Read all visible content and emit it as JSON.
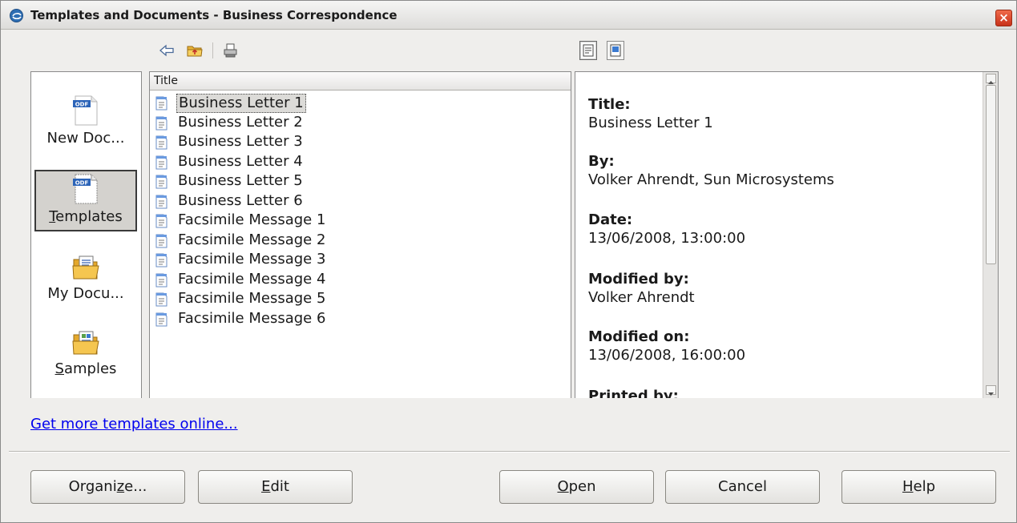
{
  "window": {
    "title": "Templates and Documents - Business Correspondence",
    "close_glyph": "×"
  },
  "toolbar": {
    "icons": [
      "back-icon",
      "up-folder-icon",
      "print-icon"
    ],
    "view_icons": [
      "document-properties-view-icon",
      "preview-view-icon"
    ]
  },
  "nav": {
    "items": [
      {
        "label": "New Doc...",
        "icon": "new-document-icon",
        "badge": "ODF"
      },
      {
        "label": "Templates",
        "mnemonic": "T",
        "rest": "emplates",
        "icon": "templates-icon",
        "badge": "ODF",
        "selected": true
      },
      {
        "label": "My Docu...",
        "icon": "my-documents-folder-icon"
      },
      {
        "label": "Samples",
        "mnemonic": "S",
        "rest": "amples",
        "icon": "samples-folder-icon"
      }
    ]
  },
  "list": {
    "column_header": "Title",
    "rows": [
      "Business Letter 1",
      "Business Letter 2",
      "Business Letter 3",
      "Business Letter 4",
      "Business Letter 5",
      "Business Letter 6",
      "Facsimile Message 1",
      "Facsimile Message 2",
      "Facsimile Message 3",
      "Facsimile Message 4",
      "Facsimile Message 5",
      "Facsimile Message 6"
    ],
    "selected_index": 0
  },
  "properties": {
    "title_label": "Title:",
    "title_value": "Business Letter 1",
    "by_label": "By:",
    "by_value": "Volker Ahrendt, Sun Microsystems",
    "date_label": "Date:",
    "date_value": "13/06/2008, 13:00:00",
    "modified_by_label": "Modified by:",
    "modified_by_value": "Volker Ahrendt",
    "modified_on_label": "Modified on:",
    "modified_on_value": "13/06/2008, 16:00:00",
    "printed_by_label": "Printed by:"
  },
  "link": {
    "text": "Get more templates online..."
  },
  "buttons": {
    "organize": {
      "pre": "Organi",
      "mnemonic": "z",
      "post": "e..."
    },
    "edit": {
      "pre": "",
      "mnemonic": "E",
      "post": "dit"
    },
    "open": {
      "pre": "",
      "mnemonic": "O",
      "post": "pen"
    },
    "cancel": {
      "label": "Cancel"
    },
    "help": {
      "pre": "",
      "mnemonic": "H",
      "post": "elp"
    }
  },
  "colors": {
    "link": "#0000ee",
    "title_close": "#d8401f",
    "selection": "#dcdbd8"
  }
}
